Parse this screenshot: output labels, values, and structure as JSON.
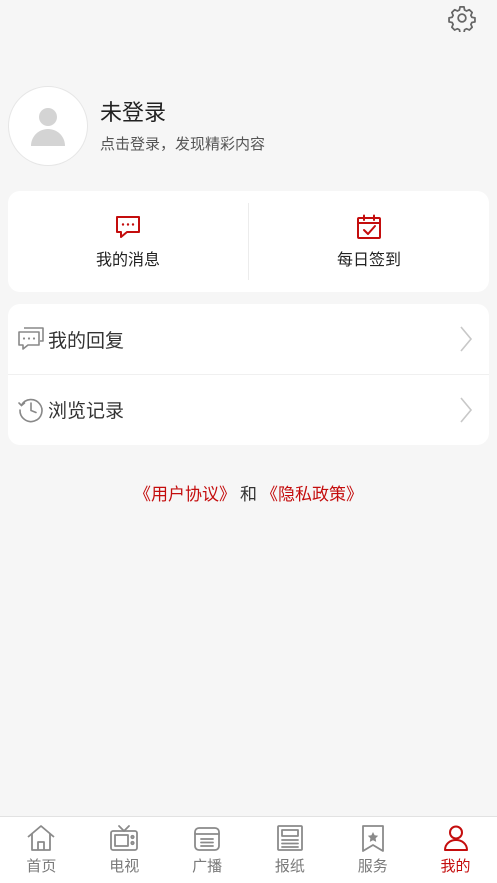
{
  "header": {
    "settings_icon": "gear-icon"
  },
  "profile": {
    "name": "未登录",
    "subtitle": "点击登录，发现精彩内容",
    "avatar_icon": "user-placeholder-icon"
  },
  "quick_actions": [
    {
      "label": "我的消息",
      "icon": "message-icon"
    },
    {
      "label": "每日签到",
      "icon": "calendar-check-icon"
    }
  ],
  "menu": [
    {
      "label": "我的回复",
      "icon": "chat-bubbles-icon"
    },
    {
      "label": "浏览记录",
      "icon": "history-icon"
    }
  ],
  "agreement": {
    "user_agreement": "《用户协议》",
    "and": "和",
    "privacy_policy": "《隐私政策》"
  },
  "tabbar": [
    {
      "label": "首页",
      "icon": "home-icon",
      "active": false
    },
    {
      "label": "电视",
      "icon": "tv-icon",
      "active": false
    },
    {
      "label": "广播",
      "icon": "radio-icon",
      "active": false
    },
    {
      "label": "报纸",
      "icon": "newspaper-icon",
      "active": false
    },
    {
      "label": "服务",
      "icon": "service-star-icon",
      "active": false
    },
    {
      "label": "我的",
      "icon": "user-icon",
      "active": true
    }
  ],
  "colors": {
    "accent": "#c40d0d",
    "background": "#f6f6f6",
    "inactive": "#7a7a7a"
  }
}
